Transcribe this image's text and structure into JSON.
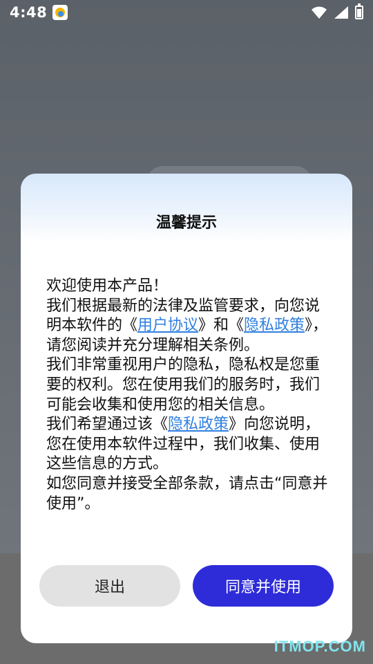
{
  "status_bar": {
    "time": "4:48",
    "icons": [
      "app-notification-icon",
      "wifi-icon",
      "signal-icon",
      "battery-icon"
    ]
  },
  "dialog": {
    "title": "温馨提示",
    "body": {
      "p1": "欢迎使用本产品！",
      "p2_a": "我们根据最新的法律及监管要求，向您说明本软件的《",
      "link_user_agreement": "用户协议",
      "p2_b": "》和《",
      "link_privacy_policy_1": "隐私政策",
      "p2_c": "》，请您阅读并充分理解相关条例。",
      "p3": "我们非常重视用户的隐私，隐私权是您重要的权利。您在使用我们的服务时，我们可能会收集和使用您的相关信息。",
      "p4_a": "我们希望通过该《",
      "link_privacy_policy_2": "隐私政策",
      "p4_b": "》向您说明，您在使用本软件过程中，我们收集、使用这些信息的方式。",
      "p5": "如您同意并接受全部条款，请点击“同意并使用”。"
    },
    "buttons": {
      "exit": "退出",
      "agree": "同意并使用"
    }
  },
  "watermark": "ITMOP.COM",
  "colors": {
    "accent": "#2e2cd8",
    "link": "#2f7fe0",
    "exit_button_bg": "#e2e2e2",
    "dialog_header_tint": "#d7e8fb"
  }
}
